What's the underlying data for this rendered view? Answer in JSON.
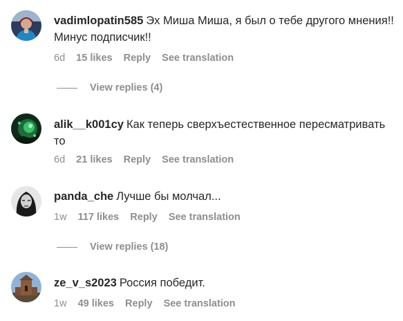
{
  "comments": [
    {
      "username": "vadimlopatin585",
      "text": "Эх Миша Миша, я был о тебе другого мнения!! Минус подписчик!!",
      "time": "6d",
      "likes": "15 likes",
      "reply": "Reply",
      "translate": "See translation",
      "view_replies": "View replies (4)",
      "avatar_icon": "user-avatar-icon"
    },
    {
      "username": "alik__k001cy",
      "text": "Как теперь сверхъестественное пересматривать то",
      "time": "6d",
      "likes": "21 likes",
      "reply": "Reply",
      "translate": "See translation",
      "avatar_icon": "user-avatar-icon"
    },
    {
      "username": "panda_che",
      "text": "Лучше бы молчал...",
      "time": "1w",
      "likes": "117 likes",
      "reply": "Reply",
      "translate": "See translation",
      "view_replies": "View replies (18)",
      "avatar_icon": "user-avatar-icon"
    },
    {
      "username": "ze_v_s2023",
      "text": "Россия победит.",
      "time": "1w",
      "likes": "49 likes",
      "reply": "Reply",
      "translate": "See translation",
      "avatar_icon": "user-avatar-icon"
    }
  ],
  "colors": {
    "text": "#262626",
    "secondary": "#8e8e8e",
    "background": "#ffffff"
  }
}
